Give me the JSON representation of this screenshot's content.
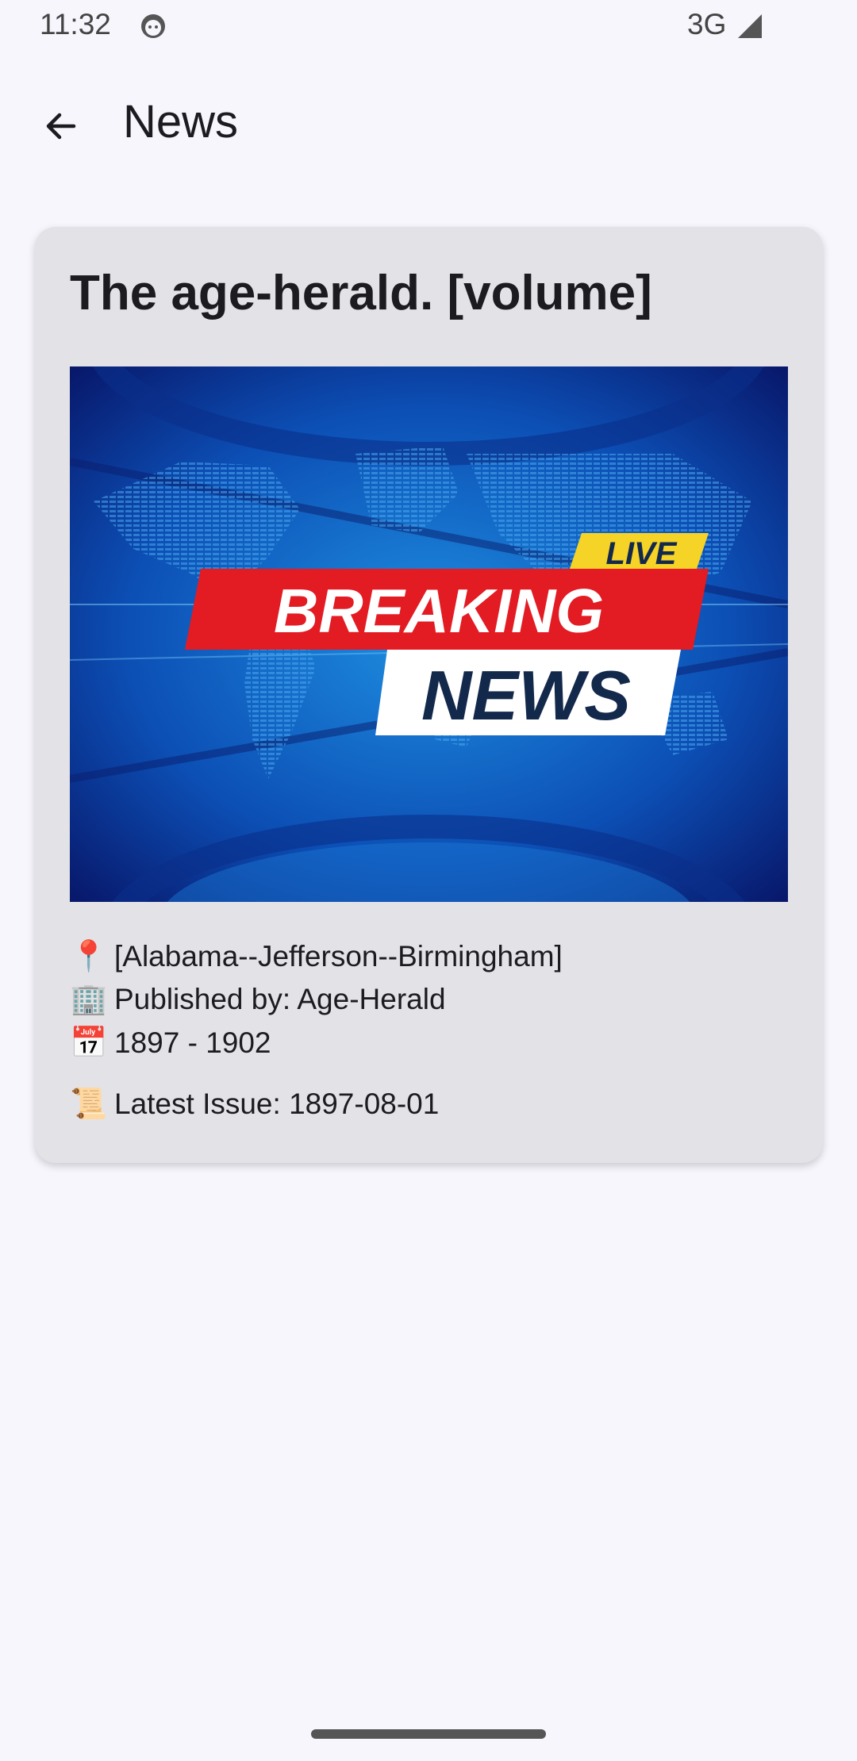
{
  "status_bar": {
    "time": "11:32",
    "network": "3G"
  },
  "app_bar": {
    "title": "News"
  },
  "card": {
    "title": "The age-herald. [volume]",
    "image": {
      "badge": "LIVE",
      "line1": "BREAKING",
      "line2": "NEWS"
    },
    "location": {
      "icon": "📍",
      "text": "[Alabama--Jefferson--Birmingham]"
    },
    "publisher": {
      "icon": "🏢",
      "text": "Published by: Age-Herald"
    },
    "years": {
      "icon": "📅",
      "text": "1897 - 1902"
    },
    "latest_issue": {
      "icon": "📜",
      "text": "Latest Issue: 1897-08-01"
    }
  },
  "colors": {
    "background": "#f7f6fc",
    "card": "#e3e2e7",
    "banner_red": "#e31b23",
    "banner_yellow": "#f5d327",
    "news_text": "#13294b"
  }
}
